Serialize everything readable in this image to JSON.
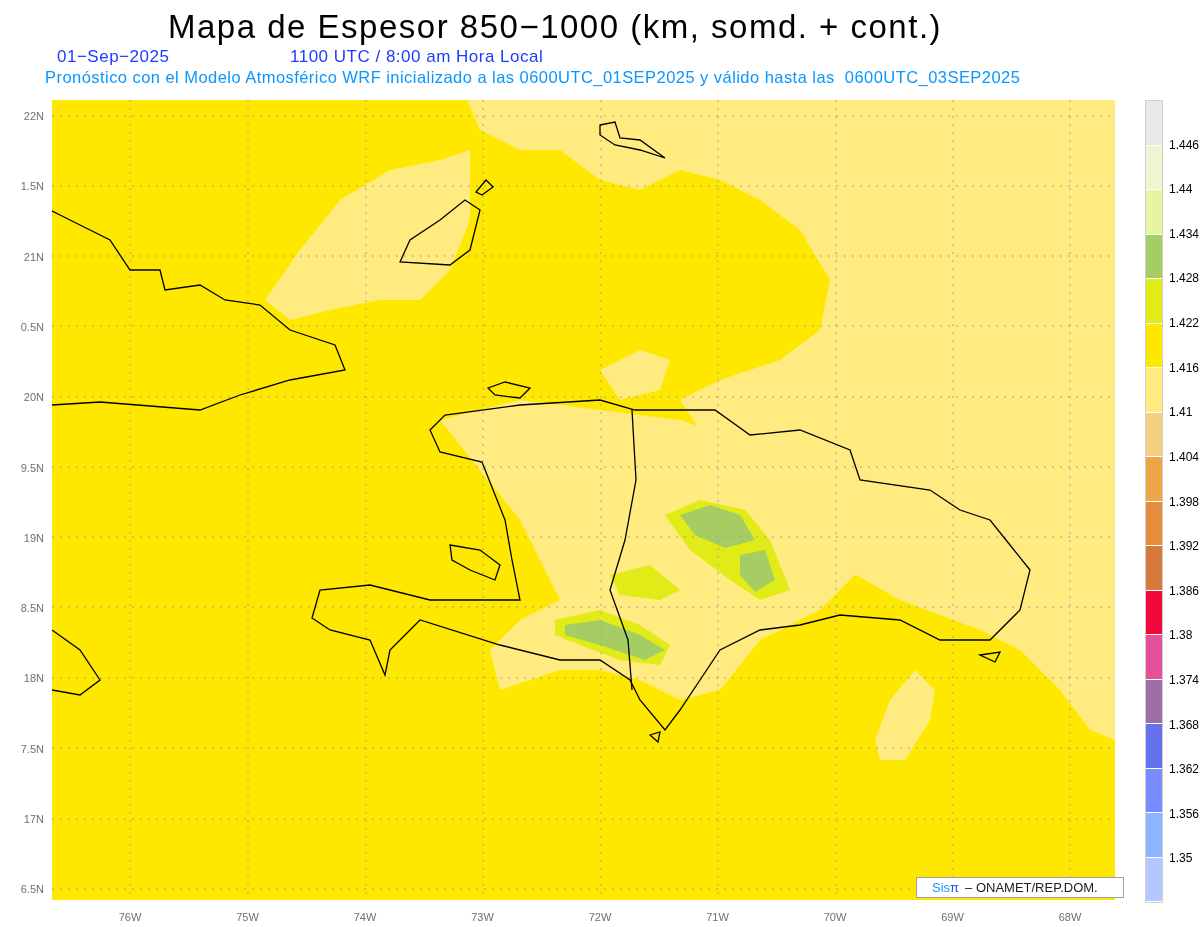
{
  "title": "Mapa de Espesor 850−1000 (km, somd. + cont.)",
  "date": "01−Sep−2025",
  "time": "1100 UTC / 8:00 am Hora Local",
  "subtitle": "Pronóstico con el Modelo Atmosférico WRF inicializado a las 0600UTC_01SEP2025 y válido hasta las  0600UTC_03SEP2025",
  "y_axis": [
    "22N",
    "1.5N",
    "21N",
    "0.5N",
    "20N",
    "9.5N",
    "19N",
    "8.5N",
    "18N",
    "7.5N",
    "17N",
    "6.5N"
  ],
  "x_axis": [
    "76W",
    "75W",
    "74W",
    "73W",
    "72W",
    "71W",
    "70W",
    "69W",
    "68W"
  ],
  "colorbar": {
    "segments": [
      {
        "color": "#e8e8e8"
      },
      {
        "color": "#eef5d2"
      },
      {
        "color": "#e6f5a0"
      },
      {
        "color": "#a6cc64"
      },
      {
        "color": "#e0eb18"
      },
      {
        "color": "#ffe800"
      },
      {
        "color": "#ffeb80"
      },
      {
        "color": "#f2d080"
      },
      {
        "color": "#eba64a"
      },
      {
        "color": "#e68c3c"
      },
      {
        "color": "#d7783c"
      },
      {
        "color": "#f00a3c"
      },
      {
        "color": "#e6509b"
      },
      {
        "color": "#9b6ea5"
      },
      {
        "color": "#6472f0"
      },
      {
        "color": "#788cff"
      },
      {
        "color": "#8cb4ff"
      },
      {
        "color": "#b4c8ff"
      }
    ],
    "labels": [
      "1.446",
      "1.44",
      "1.434",
      "1.428",
      "1.422",
      "1.416",
      "1.41",
      "1.404",
      "1.398",
      "1.392",
      "1.386",
      "1.38",
      "1.374",
      "1.368",
      "1.362",
      "1.356",
      "1.35"
    ]
  },
  "credit": {
    "brand": "Sis",
    "brand_symbol": "π",
    "text": "– ONAMET/REP.DOM."
  }
}
